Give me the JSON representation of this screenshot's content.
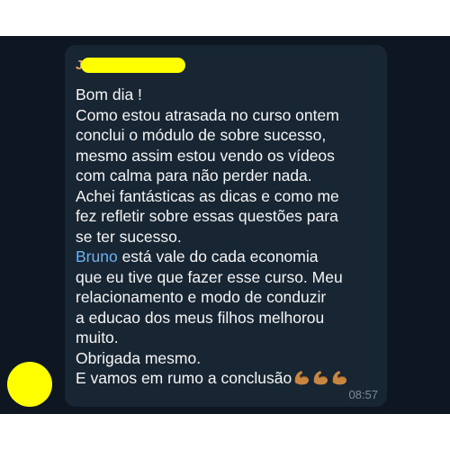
{
  "chat": {
    "sender_visible_text": "Jo",
    "message": {
      "line1": "Bom dia !",
      "line2": "Como estou atrasada no curso ontem",
      "line3": "conclui o módulo de sobre sucesso,",
      "line4": "mesmo assim estou vendo os vídeos",
      "line5": "com calma para não perder nada.",
      "line6": "Achei fantásticas as dicas e como me",
      "line7": "fez refletir sobre essas questões para",
      "line8": "se ter sucesso.",
      "mention": "Bruno",
      "line9_rest": " está vale do cada economia",
      "line10": "que eu tive que fazer esse curso. Meu",
      "line11": "relacionamento e modo de conduzir",
      "line12": "a educao dos meus filhos melhorou",
      "line13": "muito.",
      "line14": "Obrigada mesmo.",
      "line15": "E vamos em rumo a conclusão"
    },
    "emoji_icons": [
      "flexed-biceps-icon",
      "flexed-biceps-icon",
      "flexed-biceps-icon"
    ],
    "time": "08:57"
  },
  "colors": {
    "background": "#0e1621",
    "bubble": "#182533",
    "text": "#f5f5f5",
    "mention": "#6ab3f3",
    "sender": "#e8a35a",
    "time": "#7d8b99",
    "redaction": "#ffff00"
  }
}
